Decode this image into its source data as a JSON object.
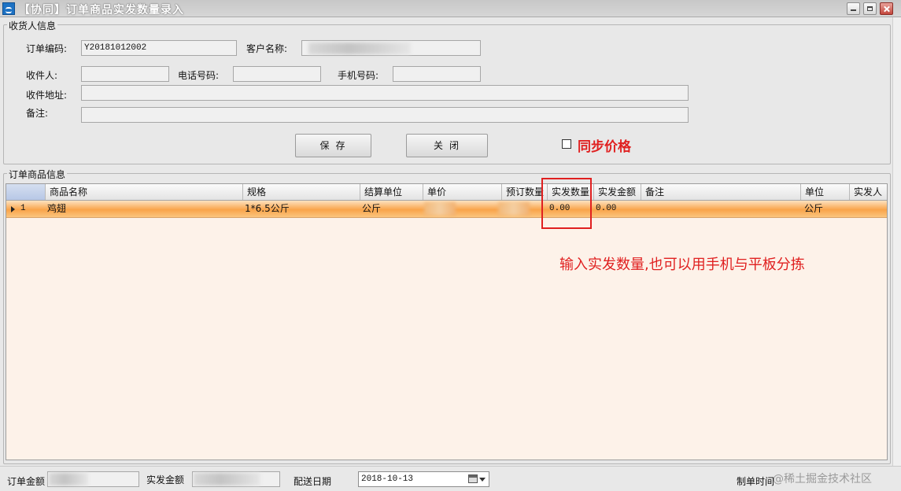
{
  "window": {
    "title": "【协同】订单商品实发数量录入"
  },
  "receiver_group": {
    "title": "收货人信息",
    "order_no_label": "订单编码:",
    "order_no_value": "Y20181012002",
    "customer_label": "客户名称:",
    "recipient_label": "收件人:",
    "phone_label": "电话号码:",
    "mobile_label": "手机号码:",
    "address_label": "收件地址:",
    "remark_label": "备注:"
  },
  "actions": {
    "save_label": "保存",
    "close_label": "关闭",
    "sync_price_label": "同步价格",
    "sync_price_checked": false
  },
  "items_group": {
    "title": "订单商品信息",
    "columns": [
      "商品名称",
      "规格",
      "结算单位",
      "单价",
      "预订数量",
      "实发数量",
      "实发金额",
      "备注",
      "单位",
      "实发人"
    ],
    "rows": [
      {
        "index": "1",
        "name": "鸡翅",
        "spec": "1*6.5公斤",
        "settle_unit": "公斤",
        "actual_qty": "0.00",
        "actual_amount": "0.00",
        "unit": "公斤"
      }
    ]
  },
  "annotation": {
    "text": "输入实发数量,也可以用手机与平板分拣",
    "color": "#e02020"
  },
  "footer": {
    "order_amount_label": "订单金额",
    "actual_amount_label": "实发金额",
    "delivery_date_label": "配送日期",
    "delivery_date_value": "2018-10-13",
    "create_time_label": "制单时间",
    "watermark": "@稀土掘金技术社区"
  }
}
